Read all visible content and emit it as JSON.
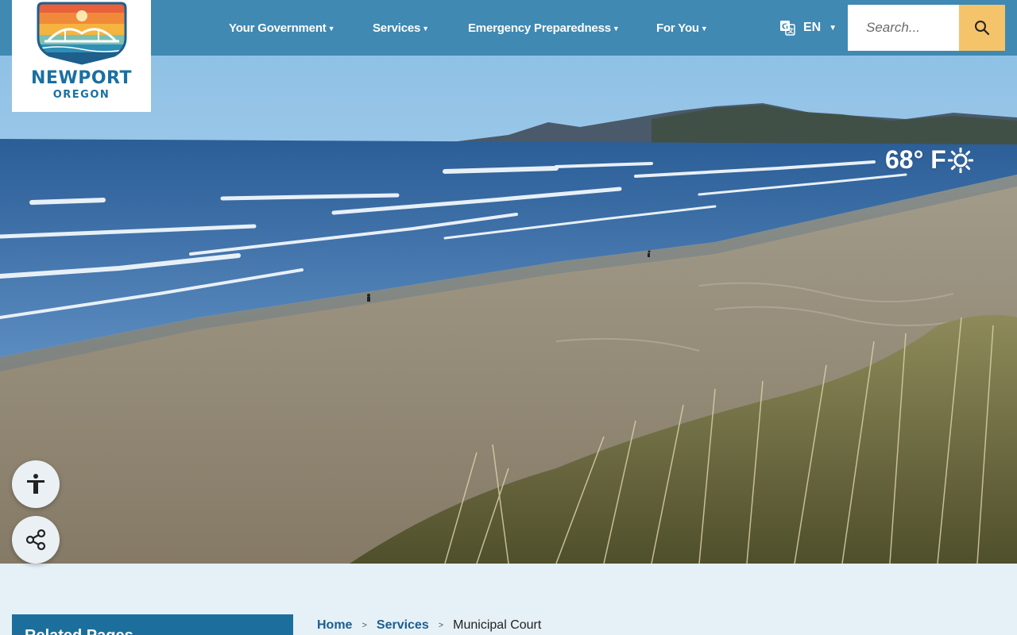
{
  "header": {
    "logo": {
      "name": "NEWPORT",
      "subtitle": "OREGON"
    },
    "nav": [
      {
        "label": "Your Government"
      },
      {
        "label": "Services"
      },
      {
        "label": "Emergency Preparedness"
      },
      {
        "label": "For You"
      }
    ],
    "language": {
      "code": "EN",
      "icon": "translate-icon"
    },
    "search": {
      "placeholder": "Search...",
      "icon": "search-icon"
    }
  },
  "hero": {
    "weather": {
      "temperature": "68° F",
      "icon": "sun-icon"
    }
  },
  "floating_buttons": [
    {
      "icon": "accessibility-icon"
    },
    {
      "icon": "share-icon"
    }
  ],
  "sidebar": {
    "title": "Related Pages"
  },
  "breadcrumb": {
    "items": [
      "Home",
      "Services"
    ],
    "current": "Municipal Court"
  },
  "colors": {
    "header": "#3f89b3",
    "search_button": "#f5c36a",
    "related_box": "#1c6f9c",
    "page_background": "#e6f1f7",
    "link": "#1c5e8f"
  }
}
